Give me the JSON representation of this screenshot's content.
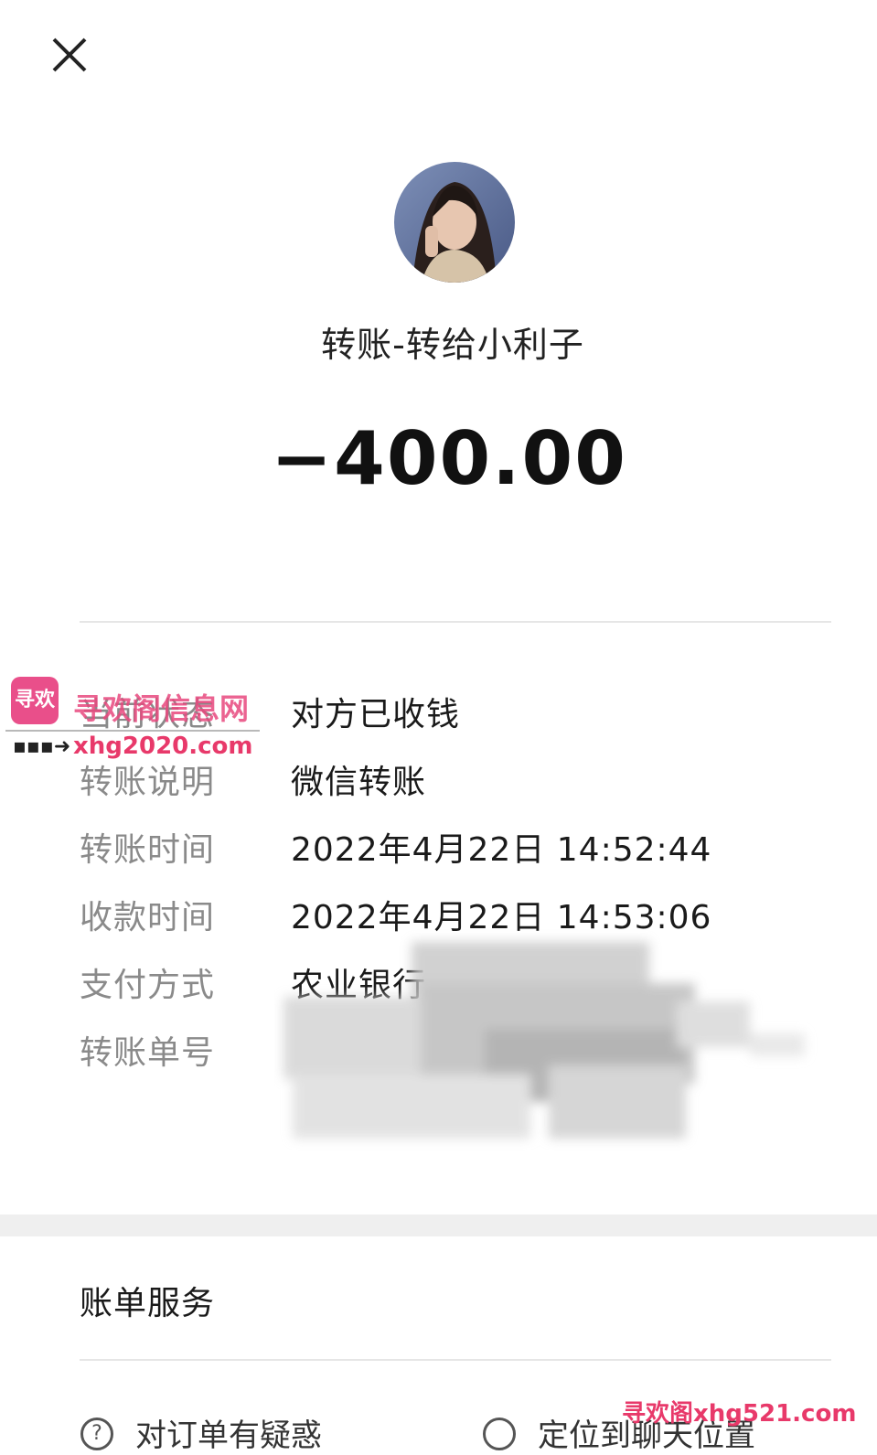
{
  "header": {
    "close_icon": "close-icon"
  },
  "transaction": {
    "title": "转账-转给小利子",
    "amount": "−400.00"
  },
  "details": [
    {
      "label": "当前状态",
      "value": "对方已收钱"
    },
    {
      "label": "转账说明",
      "value": "微信转账"
    },
    {
      "label": "转账时间",
      "value": "2022年4月22日 14:52:44"
    },
    {
      "label": "收款时间",
      "value": "2022年4月22日 14:53:06"
    },
    {
      "label": "支付方式",
      "value": "农业银行"
    },
    {
      "label": "转账单号",
      "value": ""
    }
  ],
  "services": {
    "title": "账单服务",
    "actions": [
      {
        "icon": "question-icon",
        "label": "对订单有疑惑"
      },
      {
        "icon": "chat-bubble-icon",
        "label": "定位到聊天位置"
      }
    ]
  },
  "watermark": {
    "logo_text": "寻欢",
    "site_name": "寻欢阁信息网",
    "site_url": "xhg2020.com",
    "bottom_text": "寻欢阁xhg521.com",
    "accent": "#e8396a"
  }
}
